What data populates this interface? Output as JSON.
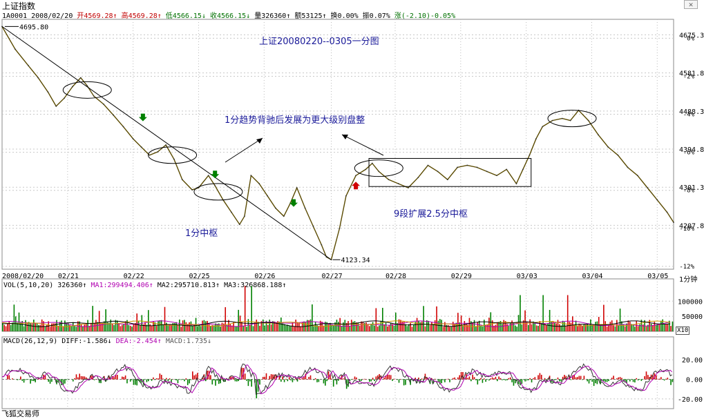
{
  "window": {
    "title": "上证指数",
    "close_glyph": "✕"
  },
  "info_line": {
    "code_date": "1A0001 2008/02/20",
    "open": "开4569.28↑",
    "high": "高4569.28↑",
    "low": "低4566.15↓",
    "close": "收4566.15↓",
    "volume": "量326360↑",
    "amount": "额53125↑",
    "turnover": "换0.00%",
    "amplitude": "振0.07%",
    "change": "涨(-2.10)-0.05%"
  },
  "chart_data": [
    {
      "type": "line",
      "panel": "price",
      "title": "上证20080220--0305一分图",
      "y_right_values": [
        4675.3,
        4581.8,
        4488.3,
        4394.8,
        4301.3,
        4207.8
      ],
      "y_right_percent": [
        "0%",
        "-2%",
        "-4%",
        "-6%",
        "-8%",
        "-10%",
        "-12%"
      ],
      "ylim": [
        4100,
        4710
      ],
      "x_labels": [
        "2008/02/20",
        "02/21",
        "02/22",
        "02/25",
        "02/26",
        "02/27",
        "02/28",
        "02/29",
        "03/03",
        "03/04",
        "03/05"
      ],
      "x_unit": "1分钟",
      "series": [
        {
          "points": [
            [
              0,
              4695.8
            ],
            [
              8,
              4640
            ],
            [
              16,
              4600
            ],
            [
              22,
              4570
            ],
            [
              28,
              4535
            ],
            [
              33,
              4500
            ],
            [
              38,
              4520
            ],
            [
              43,
              4548
            ],
            [
              48,
              4570
            ],
            [
              52,
              4550
            ],
            [
              56,
              4525
            ],
            [
              62,
              4505
            ],
            [
              68,
              4478
            ],
            [
              74,
              4450
            ],
            [
              80,
              4420
            ],
            [
              85,
              4400
            ],
            [
              90,
              4380
            ],
            [
              95,
              4388
            ],
            [
              100,
              4405
            ],
            [
              105,
              4370
            ],
            [
              110,
              4320
            ],
            [
              116,
              4295
            ],
            [
              120,
              4300
            ],
            [
              126,
              4330
            ],
            [
              130,
              4305
            ],
            [
              135,
              4270
            ],
            [
              140,
              4240
            ],
            [
              145,
              4210
            ],
            [
              148,
              4230
            ],
            [
              152,
              4330
            ],
            [
              157,
              4310
            ],
            [
              162,
              4280
            ],
            [
              167,
              4250
            ],
            [
              172,
              4230
            ],
            [
              176,
              4262
            ],
            [
              180,
              4300
            ],
            [
              185,
              4250
            ],
            [
              190,
              4205
            ],
            [
              195,
              4160
            ],
            [
              198,
              4130
            ],
            [
              201,
              4123.34
            ],
            [
              206,
              4200
            ],
            [
              210,
              4280
            ],
            [
              216,
              4330
            ],
            [
              222,
              4345
            ],
            [
              226,
              4360
            ],
            [
              230,
              4340
            ],
            [
              236,
              4320
            ],
            [
              242,
              4310
            ],
            [
              248,
              4300
            ],
            [
              254,
              4325
            ],
            [
              260,
              4355
            ],
            [
              266,
              4340
            ],
            [
              272,
              4320
            ],
            [
              278,
              4350
            ],
            [
              284,
              4355
            ],
            [
              290,
              4350
            ],
            [
              296,
              4340
            ],
            [
              302,
              4330
            ],
            [
              308,
              4345
            ],
            [
              314,
              4310
            ],
            [
              318,
              4345
            ],
            [
              322,
              4380
            ],
            [
              326,
              4420
            ],
            [
              330,
              4450
            ],
            [
              336,
              4465
            ],
            [
              342,
              4470
            ],
            [
              347,
              4465
            ],
            [
              352,
              4490
            ],
            [
              358,
              4465
            ],
            [
              364,
              4430
            ],
            [
              370,
              4400
            ],
            [
              376,
              4380
            ],
            [
              382,
              4350
            ],
            [
              388,
              4330
            ],
            [
              394,
              4300
            ],
            [
              400,
              4270
            ],
            [
              406,
              4240
            ],
            [
              410,
              4215
            ]
          ]
        }
      ],
      "annotations": [
        {
          "text": "1分趋势背驰后发展为更大级别盘整",
          "near": [
            150,
            4490
          ]
        },
        {
          "text": "9段扩展2.5分中枢",
          "near": [
            280,
            4265
          ]
        },
        {
          "text": "1分中枢",
          "near": [
            120,
            4215
          ]
        },
        {
          "text": "4695.80",
          "near": [
            0,
            4695.8
          ]
        },
        {
          "text": "4123.34",
          "near": [
            201,
            4123.34
          ]
        }
      ],
      "trend_line": [
        [
          0,
          4695.8
        ],
        [
          201,
          4123.34
        ]
      ],
      "ellipses": [
        [
          52,
          4540
        ],
        [
          104,
          4380
        ],
        [
          132,
          4290
        ],
        [
          230,
          4348
        ],
        [
          348,
          4470
        ]
      ],
      "box": {
        "x0": 224,
        "x1": 323,
        "y0": 4303,
        "y1": 4372
      },
      "down_arrows": [
        [
          86,
          4470
        ],
        [
          130,
          4330
        ],
        [
          178,
          4260
        ]
      ],
      "up_arrows": [
        [
          216,
          4308
        ]
      ]
    },
    {
      "type": "bar",
      "panel": "volume",
      "indicator": "VOL(5,10,20)",
      "value": "326360↑",
      "ma1": "MA1:299494.406↑",
      "ma2": "MA2:295710.813↑",
      "ma3": "MA3:326868.188↑",
      "y_right_values": [
        100000,
        50000
      ],
      "y_right_labels": [
        "100000",
        "50000"
      ],
      "ylim": [
        0,
        160000
      ],
      "scale_badge": "X10"
    },
    {
      "type": "bar",
      "panel": "macd",
      "indicator": "MACD(26,12,9)",
      "diff": "DIFF:-1.586↓",
      "dea": "DEA:-2.454↑",
      "macd": "MACD:1.735↓",
      "y_right_values": [
        20,
        0,
        -20
      ],
      "y_right_labels": [
        "20.00",
        "0.00",
        "-20.00"
      ],
      "ylim": [
        -30,
        35
      ]
    }
  ],
  "footer": {
    "brand": "飞狐交易师"
  },
  "colors": {
    "up": "#d00000",
    "down": "#008000",
    "grid": "#c8c8c8",
    "ma1": "#b000b0",
    "ma2": "#cc9900",
    "ma3": "#000000",
    "title_blue": "#1a1a99"
  }
}
